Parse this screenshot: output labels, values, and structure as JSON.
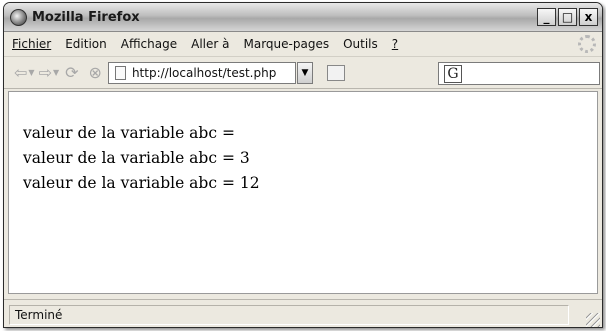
{
  "window": {
    "title": "Mozilla Firefox",
    "controls": {
      "minimize": "_",
      "maximize": "□",
      "close": "x"
    }
  },
  "menubar": {
    "items": [
      {
        "label": "Fichier"
      },
      {
        "label": "Edition"
      },
      {
        "label": "Affichage"
      },
      {
        "label": "Aller à"
      },
      {
        "label": "Marque-pages"
      },
      {
        "label": "Outils"
      },
      {
        "label": "?"
      }
    ]
  },
  "navbar": {
    "icons": [
      "back-arrow-icon",
      "forward-arrow-icon",
      "reload-icon",
      "stop-icon",
      "page-icon",
      "go-icon",
      "google-icon"
    ],
    "url": "http://localhost/test.php"
  },
  "content": {
    "lines": [
      "valeur de la variable abc =",
      "valeur de la variable abc = 3",
      "valeur de la variable abc = 12"
    ]
  },
  "statusbar": {
    "text": "Terminé"
  }
}
